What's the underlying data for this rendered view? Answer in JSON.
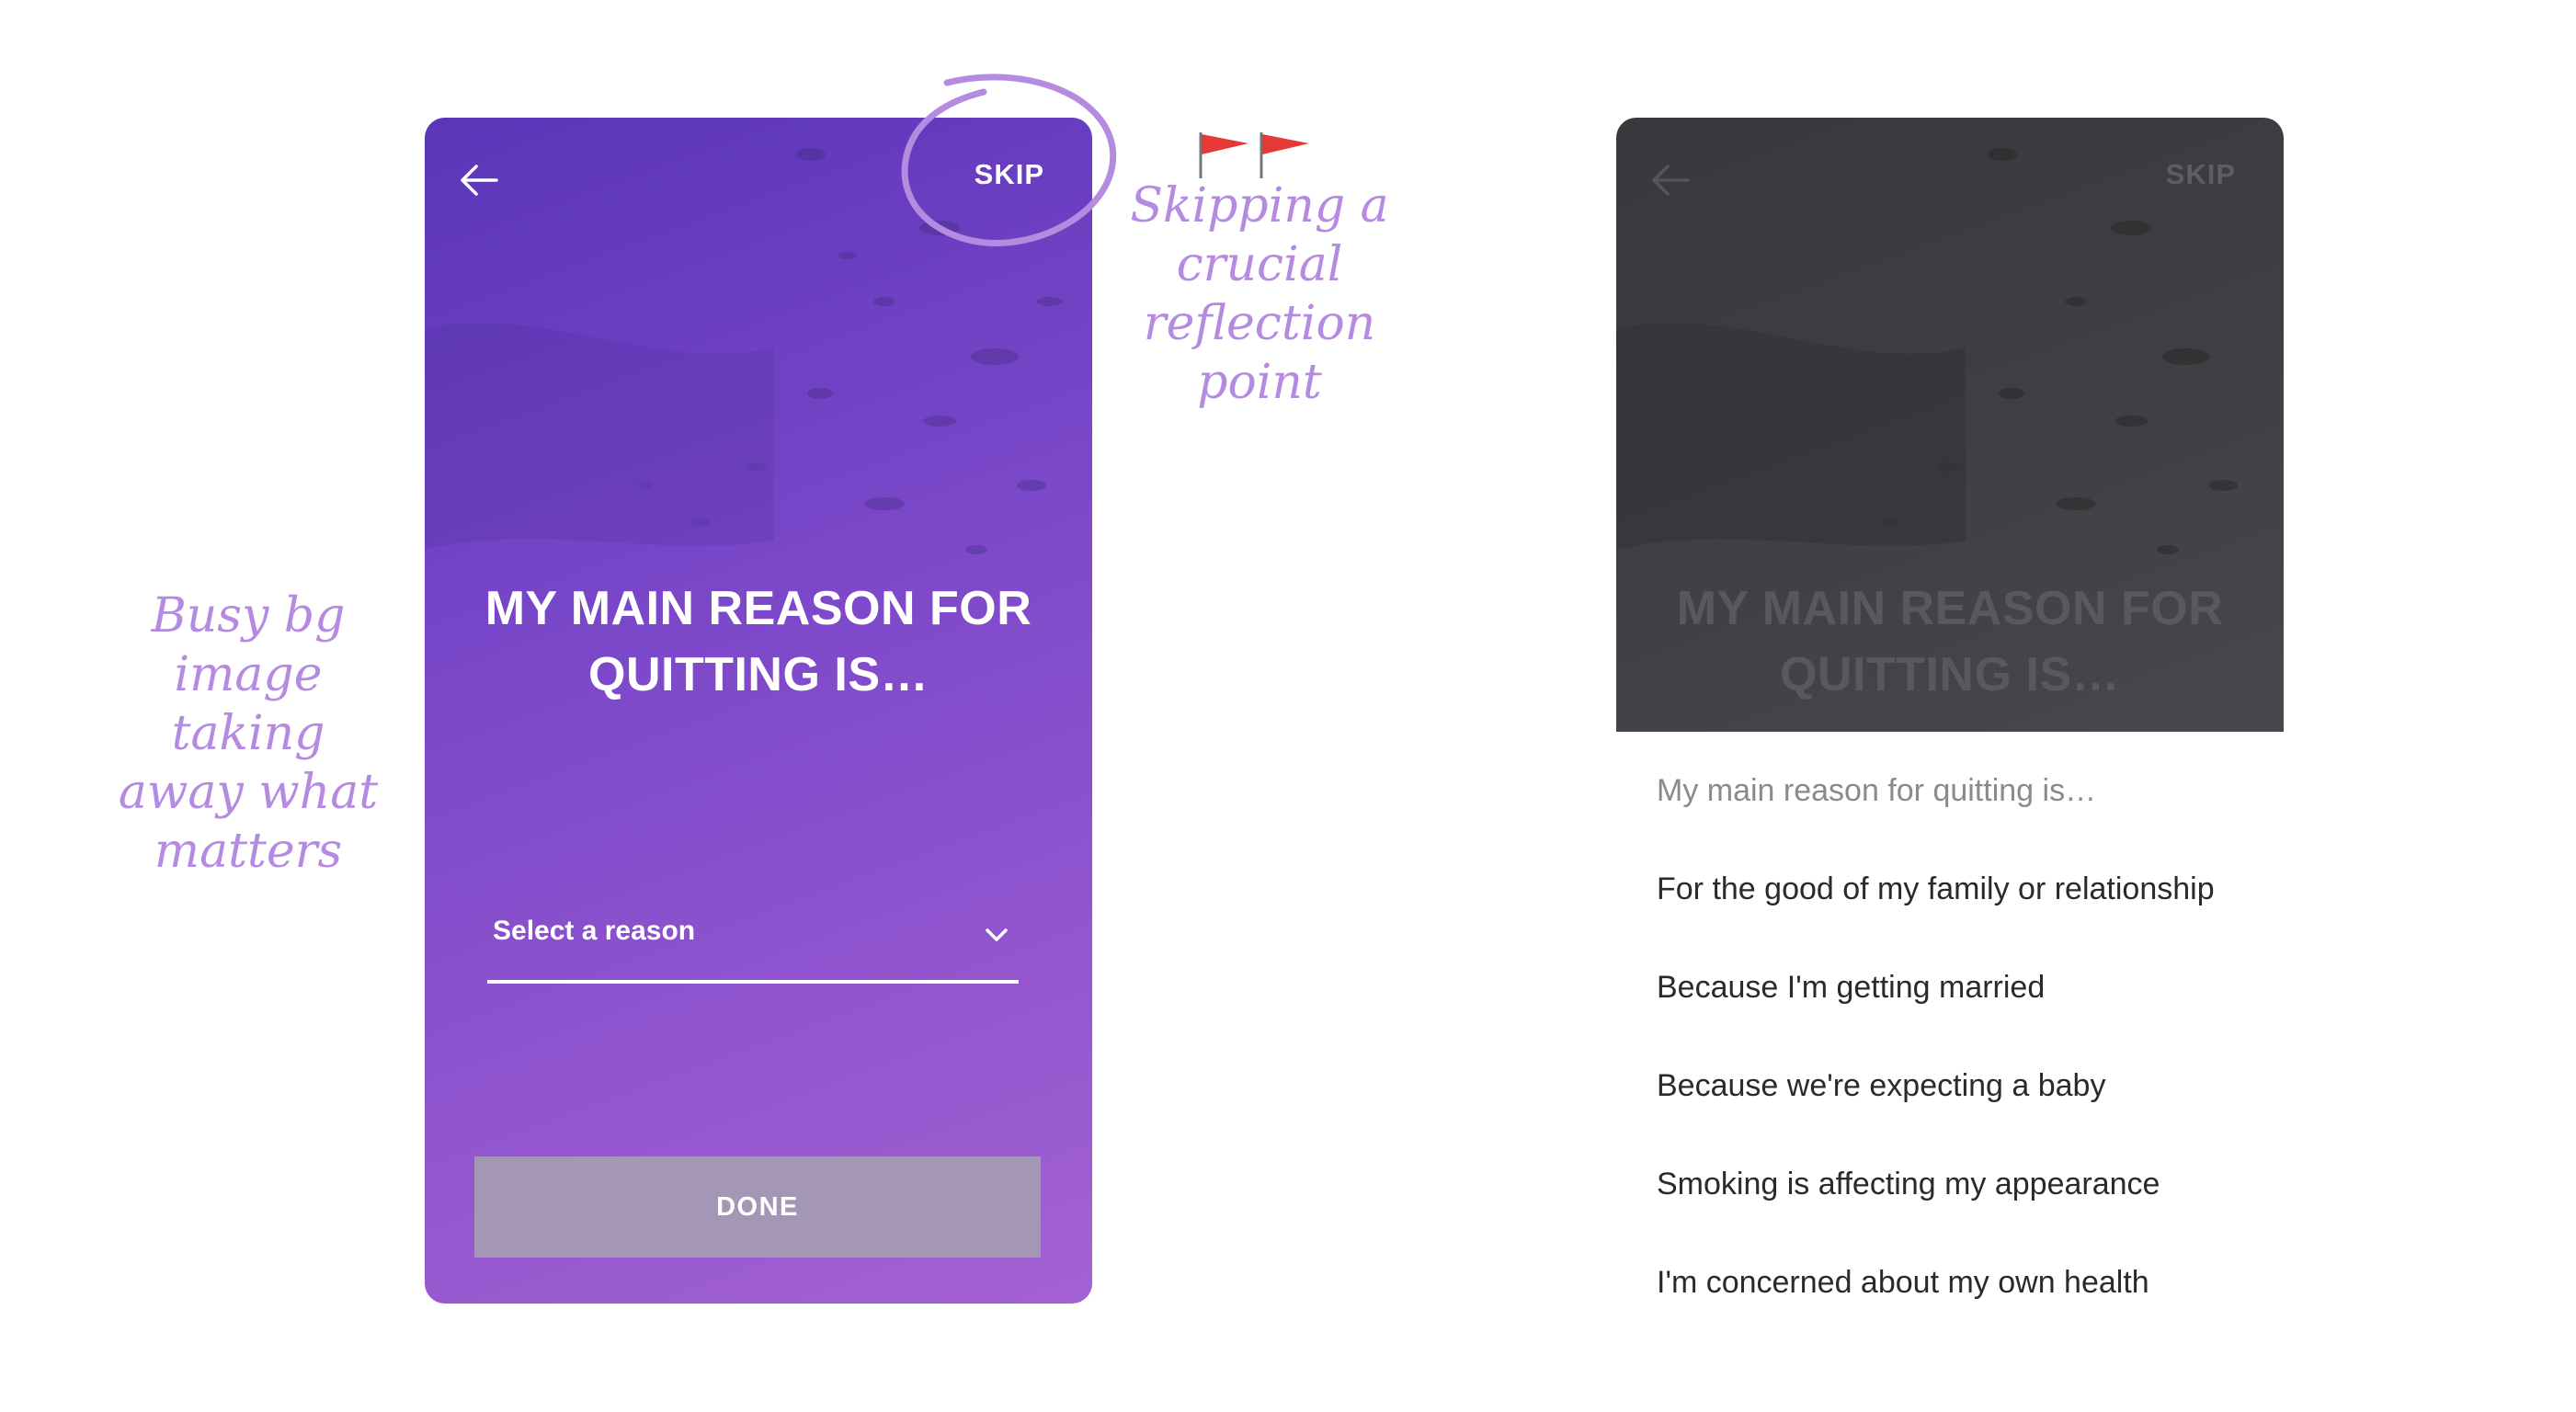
{
  "left_screen": {
    "back_icon": "arrow-left-icon",
    "skip_label": "SKIP",
    "question_line1": "MY MAIN REASON FOR",
    "question_line2": "QUITTING IS…",
    "select_label": "Select a reason",
    "select_icon": "chevron-down-icon",
    "done_label": "DONE",
    "colors": {
      "gradient_start": "#5a35b8",
      "gradient_end": "#a462d3",
      "done_button": "#a497b5"
    }
  },
  "annotations": {
    "skip_note_lines": [
      "Skipping a",
      "crucial",
      "reflection",
      "point"
    ],
    "busy_note_lines": [
      "Busy bg",
      "image taking",
      "away what",
      "matters"
    ],
    "flag_icon": "red-flag-icon",
    "color": "#b48be0"
  },
  "right_screen": {
    "back_icon": "arrow-left-icon",
    "skip_label": "SKIP",
    "question_line1": "MY MAIN REASON FOR",
    "question_line2": "QUITTING IS…",
    "picker": {
      "placeholder": "My main reason for quitting is…",
      "options": [
        "For the good of my family or relationship",
        "Because I'm getting married",
        "Because we're expecting a baby",
        "Smoking is affecting my appearance",
        "I'm concerned about my own health"
      ]
    }
  }
}
